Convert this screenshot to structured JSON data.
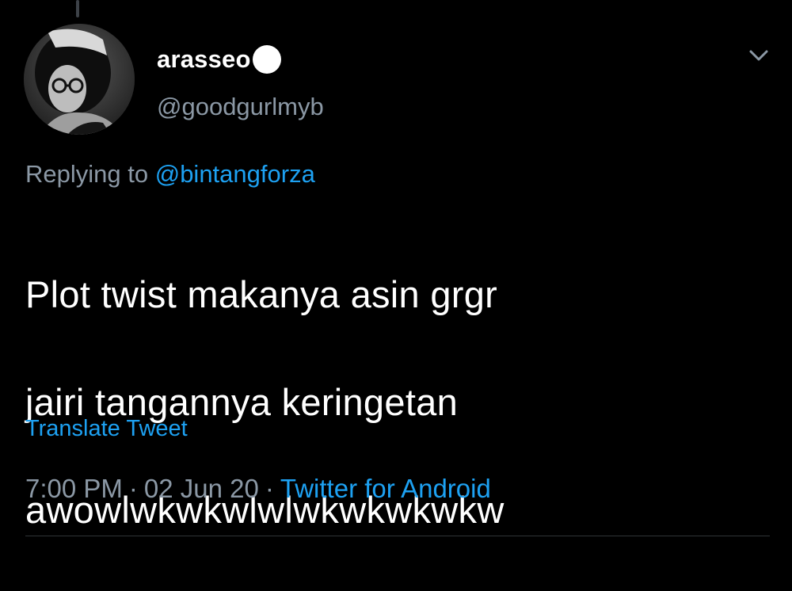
{
  "tweet": {
    "display_name": "arasseo",
    "name_emoji": "white-circle-icon",
    "handle": "@goodgurlmyb",
    "replying_label": "Replying to",
    "replying_to": "@bintangforza",
    "text_lines": [
      "Plot twist makanya asin grgr",
      "jairi tangannya keringetan",
      "awowlwkwkwlwlwkwkwkwkw"
    ],
    "translate_label": "Translate Tweet",
    "time": "7:00 PM",
    "separator": "·",
    "date": "02 Jun 20",
    "source": "Twitter for Android"
  },
  "colors": {
    "background": "#000000",
    "primary_text": "#ffffff",
    "secondary_text": "#8b98a5",
    "accent": "#1da1f2",
    "divider": "#2f3336"
  },
  "icons": {
    "more": "chevron-down-icon",
    "avatar": "avatar-photo"
  }
}
